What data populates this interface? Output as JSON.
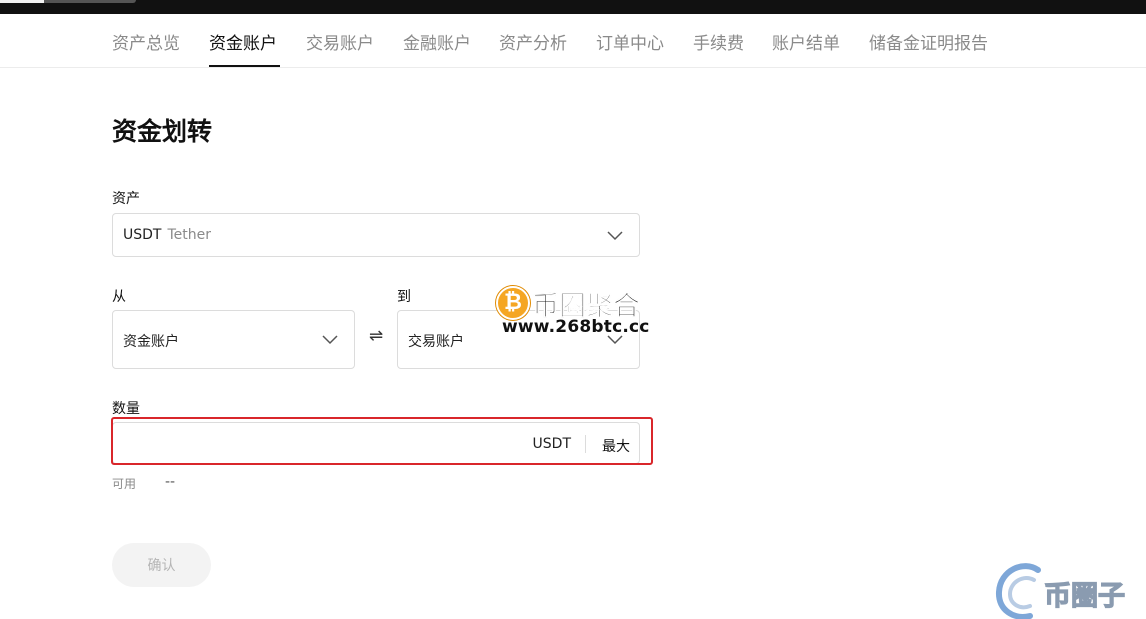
{
  "nav": {
    "items": [
      {
        "label": "资产总览"
      },
      {
        "label": "资金账户"
      },
      {
        "label": "交易账户"
      },
      {
        "label": "金融账户"
      },
      {
        "label": "资产分析"
      },
      {
        "label": "订单中心"
      },
      {
        "label": "手续费"
      },
      {
        "label": "账户结单"
      },
      {
        "label": "储备金证明报告"
      }
    ],
    "active_index": 1
  },
  "page": {
    "title": "资金划转"
  },
  "form": {
    "asset": {
      "label": "资产",
      "symbol": "USDT",
      "name": "Tether"
    },
    "from": {
      "label": "从",
      "value": "资金账户"
    },
    "to": {
      "label": "到",
      "value": "交易账户"
    },
    "swap_icon": "swap-arrows-icon",
    "amount": {
      "label": "数量",
      "value": "",
      "placeholder": "",
      "unit": "USDT",
      "max_label": "最大"
    },
    "available": {
      "label": "可用",
      "value": "--"
    },
    "confirm_label": "确认"
  },
  "watermarks": {
    "main": {
      "title": "币圈聚合",
      "url": "www.268btc.cc",
      "coin_glyph": "₿"
    },
    "corner": {
      "text": "币圈子"
    }
  },
  "colors": {
    "highlight": "#d9262b",
    "active_text": "#111111",
    "inactive_text": "#8a8a8a",
    "coin": "#f5a623"
  }
}
